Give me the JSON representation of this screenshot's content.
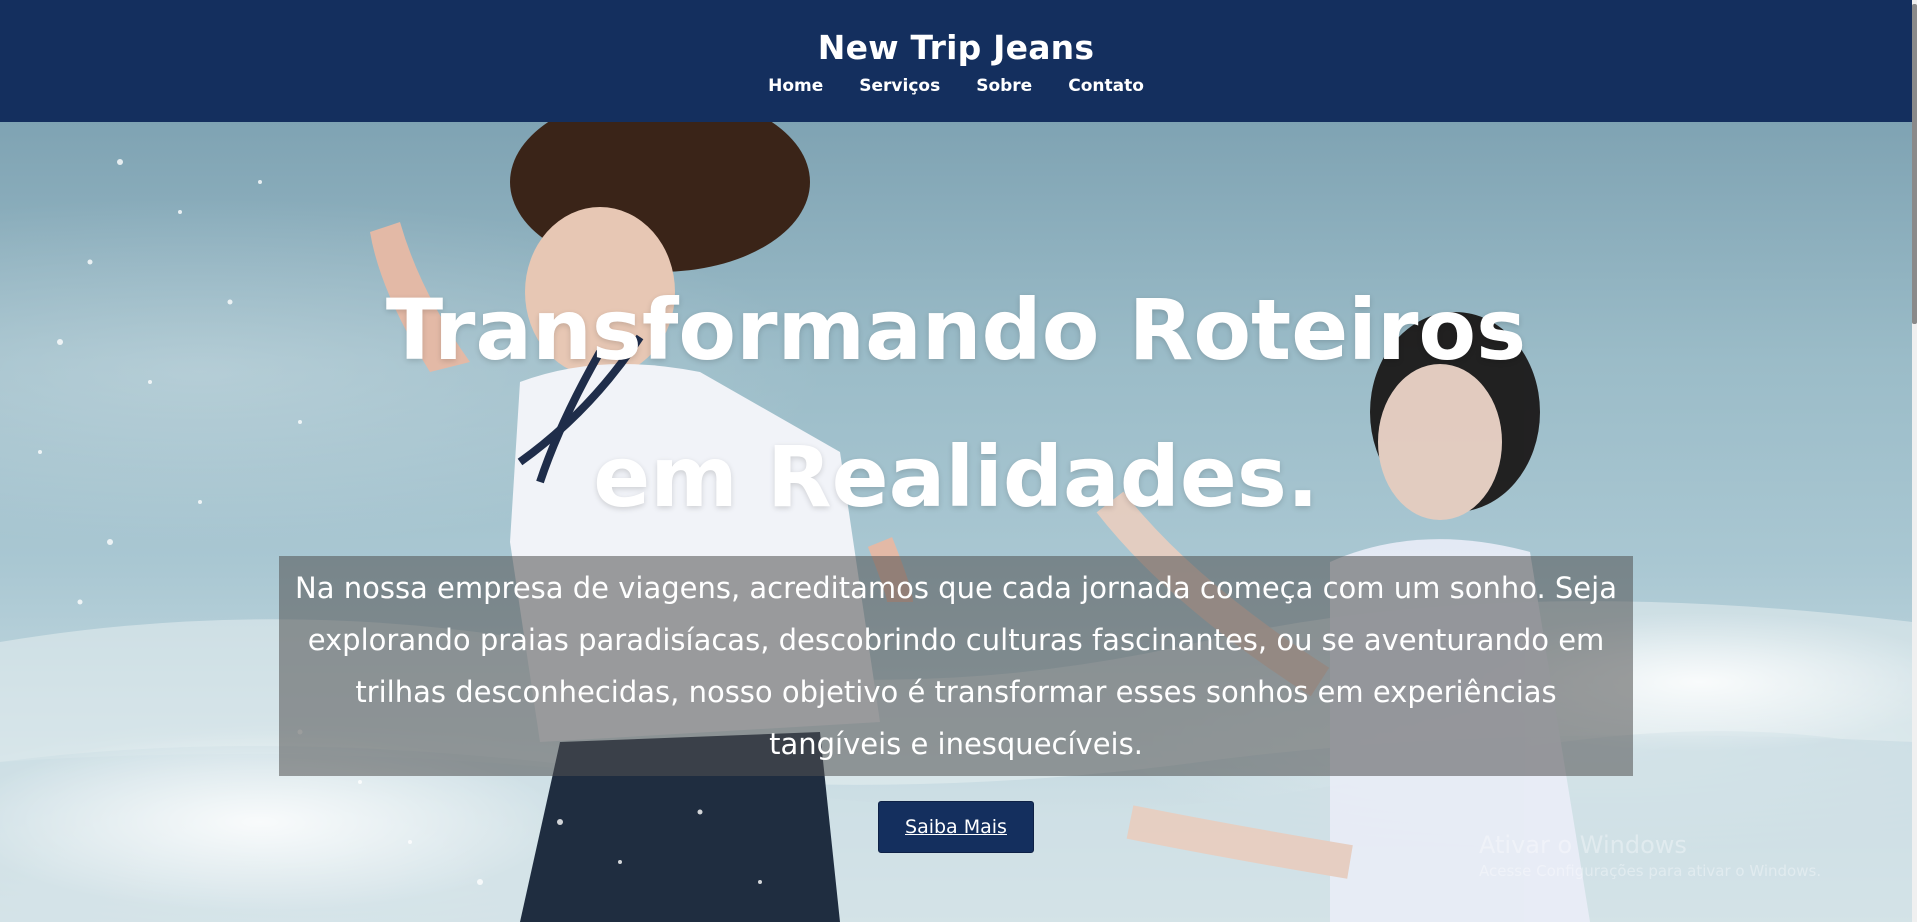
{
  "header": {
    "brand": "New Trip Jeans",
    "nav": [
      "Home",
      "Serviços",
      "Sobre",
      "Contato"
    ]
  },
  "hero": {
    "title": "Transformando Roteiros em Realidades.",
    "description": "Na nossa empresa de viagens, acreditamos que cada jornada começa com um sonho. Seja explorando praias paradisíacas, descobrindo culturas fascinantes, ou se aventurando em trilhas desconhecidas, nosso objetivo é transformar esses sonhos em experiências tangíveis e inesquecíveis.",
    "cta_label": "Saiba Mais"
  },
  "watermark": {
    "title": "Ativar o Windows",
    "subtitle": "Acesse Configurações para ativar o Windows."
  },
  "colors": {
    "header_bg": "#142f5e",
    "button_bg": "#142f5e",
    "text_box_bg": "rgba(80,80,80,0.55)"
  }
}
